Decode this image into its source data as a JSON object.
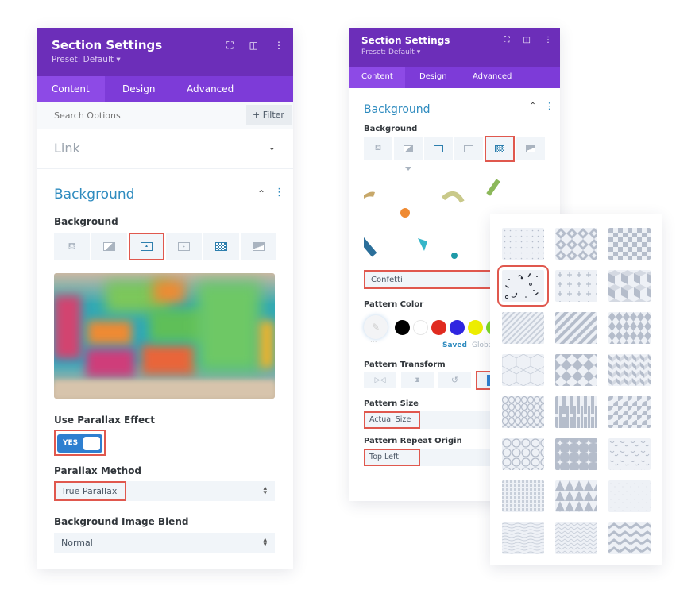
{
  "left": {
    "header": {
      "title": "Section Settings",
      "preset": "Preset: Default ▾"
    },
    "tabs": [
      "Content",
      "Design",
      "Advanced"
    ],
    "search": {
      "placeholder": "Search Options",
      "filter_label": "+ Filter"
    },
    "link_section": "Link",
    "background_section": "Background",
    "background_label": "Background",
    "bg_types": [
      "color",
      "gradient",
      "image",
      "video",
      "pattern",
      "mask"
    ],
    "selected_bg_type": "image",
    "parallax_label": "Use Parallax Effect",
    "parallax_toggle": "YES",
    "parallax_method_label": "Parallax Method",
    "parallax_method_value": "True Parallax",
    "blend_label": "Background Image Blend",
    "blend_value": "Normal"
  },
  "right": {
    "header": {
      "title": "Section Settings",
      "preset": "Preset: Default ▾"
    },
    "tabs": [
      "Content",
      "Design",
      "Advanced"
    ],
    "background_section": "Background",
    "background_label": "Background",
    "selected_bg_type": "pattern",
    "pattern_value": "Confetti",
    "pattern_color_label": "Pattern Color",
    "swatches": [
      "#000000",
      "#ffffff",
      "#e02b20",
      "#2f26e0",
      "#eded00",
      "#7cda24"
    ],
    "saved_label": "Saved",
    "global_label": "Global",
    "transform_label": "Pattern Transform",
    "size_label": "Pattern Size",
    "size_value": "Actual Size",
    "origin_label": "Pattern Repeat Origin",
    "origin_value": "Top Left"
  },
  "patterns": {
    "selected": "confetti",
    "items": [
      "polka-dots",
      "diamonds",
      "checkerboard",
      "confetti",
      "crosses",
      "cubes",
      "diagonal-stripes",
      "diagonal-stripes-wide",
      "harlequin",
      "honeycomb",
      "pinwheel",
      "chevrons",
      "scales",
      "piano",
      "quarter-circles",
      "waves-circles",
      "stars",
      "smiles",
      "grid-dots",
      "triangles",
      "scattered",
      "wavy",
      "zig-zag-thin",
      "zig-zag"
    ]
  }
}
